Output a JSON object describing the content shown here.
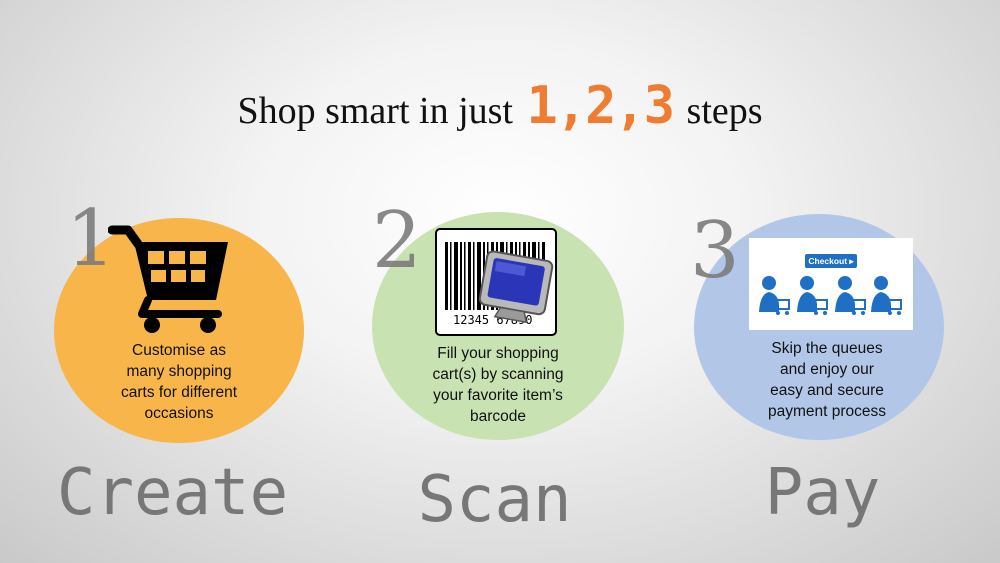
{
  "headline": {
    "prefix": "Shop smart in just",
    "numbers": "1,2,3",
    "suffix": "steps"
  },
  "steps": [
    {
      "number": "1",
      "description_lines": [
        "Customise as",
        "many shopping",
        "carts for different",
        "occasions"
      ],
      "label": "Create",
      "icon": "shopping-cart-icon",
      "color": "#f7b54a"
    },
    {
      "number": "2",
      "description_lines": [
        "Fill your shopping",
        "cart(s) by scanning",
        "your favorite item’s",
        "barcode"
      ],
      "label": "Scan",
      "icon": "barcode-scanner-icon",
      "barcode_text": "12345 67890",
      "color": "#c8e2b1"
    },
    {
      "number": "3",
      "description_lines": [
        "Skip the queues",
        "and enjoy our",
        "easy and secure",
        "payment process"
      ],
      "label": "Pay",
      "icon": "checkout-shoppers-icon",
      "checkout_label": "Checkout ▸",
      "color": "#b2c7e7"
    }
  ],
  "colors": {
    "accent": "#ee7d31",
    "step_words": "#777777"
  }
}
